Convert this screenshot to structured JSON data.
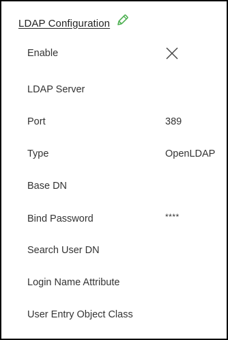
{
  "ldap": {
    "title": "LDAP Configuration",
    "icons": {
      "edit": "pencil-icon",
      "enable_state": "close-icon"
    },
    "accent_color": "#4caf50",
    "fields": {
      "enable": {
        "label": "Enable"
      },
      "server": {
        "label": "LDAP Server",
        "value": ""
      },
      "port": {
        "label": "Port",
        "value": "389"
      },
      "type": {
        "label": "Type",
        "value": "OpenLDAP"
      },
      "base_dn": {
        "label": "Base DN",
        "value": ""
      },
      "bind_password": {
        "label": "Bind Password",
        "value": "****"
      },
      "search_user_dn": {
        "label": "Search User DN",
        "value": ""
      },
      "login_name_attribute": {
        "label": "Login Name Attribute",
        "value": ""
      },
      "user_entry_object_class": {
        "label": "User Entry Object Class",
        "value": ""
      }
    }
  }
}
